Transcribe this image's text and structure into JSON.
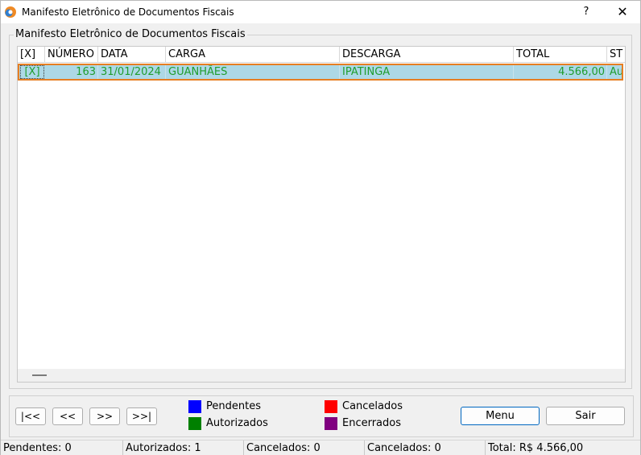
{
  "window": {
    "title": "Manifesto Eletrônico de Documentos Fiscais",
    "help": "?",
    "close": "✕"
  },
  "group": {
    "title": "Manifesto Eletrônico de Documentos Fiscais"
  },
  "grid": {
    "columns": [
      "[X]",
      "NÚMERO",
      "DATA",
      "CARGA",
      "DESCARGA",
      "TOTAL",
      "ST"
    ],
    "rows": [
      {
        "check": "[X]",
        "numero": "163",
        "data": "31/01/2024",
        "carga": "GUANHÃES",
        "descarga": "IPATINGA",
        "total": "4.566,00",
        "status": "Au"
      }
    ]
  },
  "nav": {
    "first": "|<<",
    "prev": "<<",
    "next": ">>",
    "last": ">>|"
  },
  "legend": [
    {
      "label": "Pendentes",
      "color": "#0000ff"
    },
    {
      "label": "Autorizados",
      "color": "#008000"
    },
    {
      "label": "Cancelados",
      "color": "#ff0000"
    },
    {
      "label": "Encerrados",
      "color": "#800080"
    }
  ],
  "actions": {
    "menu": "Menu",
    "exit": "Sair"
  },
  "status": [
    "Pendentes: 0",
    "Autorizados: 1",
    "Cancelados: 0",
    "Cancelados: 0",
    "Total: R$ 4.566,00"
  ]
}
